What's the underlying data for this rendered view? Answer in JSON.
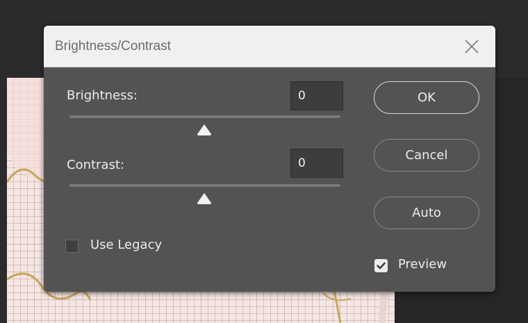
{
  "dialog": {
    "title": "Brightness/Contrast",
    "brightness": {
      "label": "Brightness:",
      "value": "0"
    },
    "contrast": {
      "label": "Contrast:",
      "value": "0"
    },
    "buttons": {
      "ok": "OK",
      "cancel": "Cancel",
      "auto": "Auto"
    },
    "use_legacy": {
      "label": "Use Legacy",
      "checked": false
    },
    "preview": {
      "label": "Preview",
      "checked": true
    }
  },
  "icons": {
    "close": "close-icon",
    "slider_thumb": "slider-thumb-icon",
    "checkmark": "checkmark-icon"
  },
  "colors": {
    "dialog_bg": "#535353",
    "titlebar_bg": "#f0f0f0",
    "canvas_bg": "#f5e6e3",
    "artwork_stroke": "#c9a55a"
  }
}
